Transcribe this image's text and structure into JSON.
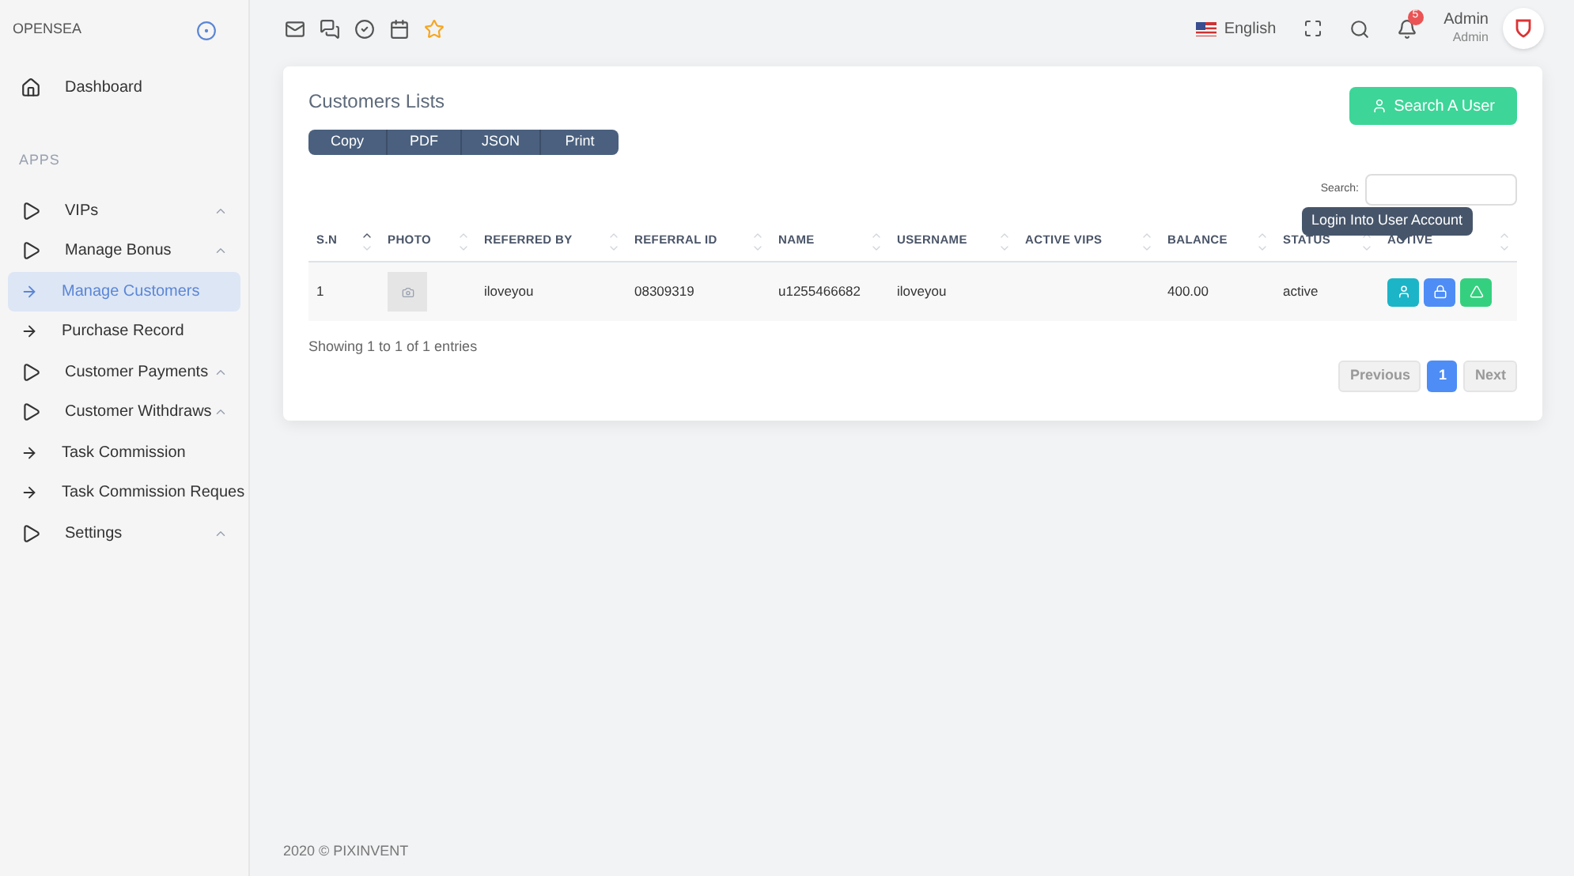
{
  "brand": "OPENSEA",
  "sidebar": {
    "items": [
      {
        "label": "Dashboard",
        "kind": "home",
        "selected": false
      },
      {
        "label": "APPS",
        "kind": "section",
        "selected": false
      },
      {
        "label": "VIPs",
        "kind": "group",
        "selected": false
      },
      {
        "label": "Manage Bonus",
        "kind": "group",
        "selected": false
      },
      {
        "label": "Manage Customers",
        "kind": "link",
        "selected": true
      },
      {
        "label": "Purchase Record",
        "kind": "link",
        "selected": false
      },
      {
        "label": "Customer Payments",
        "kind": "group",
        "selected": false
      },
      {
        "label": "Customer Withdraws",
        "kind": "group",
        "selected": false
      },
      {
        "label": "Task Commission",
        "kind": "link",
        "selected": false
      },
      {
        "label": "Task Commission Reques",
        "kind": "link",
        "selected": false
      },
      {
        "label": "Settings",
        "kind": "group",
        "selected": false
      }
    ]
  },
  "topbar": {
    "language": "English",
    "notifications": "5",
    "user_name": "Admin",
    "user_role": "Admin"
  },
  "card": {
    "title": "Customers Lists",
    "search_button": "Search A User",
    "export_buttons": [
      "Copy",
      "PDF",
      "JSON",
      "Print"
    ],
    "search_label": "Search:",
    "table": {
      "columns": [
        "S.N",
        "PHOTO",
        "REFERRED BY",
        "REFERRAL ID",
        "NAME",
        "USERNAME",
        "ACTIVE VIPS",
        "BALANCE",
        "STATUS",
        "ACTIVE"
      ],
      "rows": [
        {
          "cells": [
            "1",
            "",
            "iloveyou",
            "08309319",
            "u1255466682",
            "iloveyou",
            "",
            "400.00",
            "active"
          ],
          "actions": [
            {
              "kind": "login",
              "color": "#1bb5c7"
            },
            {
              "kind": "lock",
              "color": "#4e8df5"
            },
            {
              "kind": "warn",
              "color": "#35d07f"
            }
          ]
        }
      ]
    },
    "tooltip": "Login Into User Account",
    "info": "Showing 1 to 1 of 1 entries",
    "pagination": [
      {
        "label": "Previous",
        "selected": false
      },
      {
        "label": "1",
        "selected": true
      },
      {
        "label": "Next",
        "selected": false
      }
    ]
  },
  "footer": "2020 © PIXINVENT"
}
